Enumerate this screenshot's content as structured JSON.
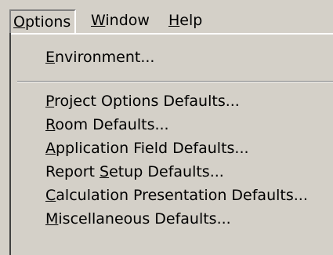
{
  "menubar": {
    "items": [
      {
        "mnemonic": "O",
        "rest": "ptions"
      },
      {
        "mnemonic": "W",
        "rest": "indow"
      },
      {
        "mnemonic": "H",
        "rest": "elp"
      }
    ]
  },
  "dropdown": {
    "items": [
      {
        "pre": "",
        "mnemonic": "E",
        "rest": "nvironment..."
      },
      {
        "pre": "",
        "mnemonic": "P",
        "rest": "roject Options Defaults..."
      },
      {
        "pre": "",
        "mnemonic": "R",
        "rest": "oom Defaults..."
      },
      {
        "pre": "",
        "mnemonic": "A",
        "rest": "pplication Field Defaults..."
      },
      {
        "pre": "Report ",
        "mnemonic": "S",
        "rest": "etup Defaults..."
      },
      {
        "pre": "",
        "mnemonic": "C",
        "rest": "alculation Presentation Defaults..."
      },
      {
        "pre": "",
        "mnemonic": "M",
        "rest": "iscellaneous Defaults..."
      }
    ]
  }
}
